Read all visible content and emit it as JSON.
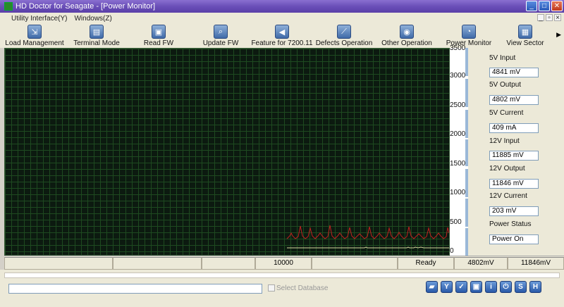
{
  "window": {
    "title": "HD Doctor for Seagate - [Power Monitor]"
  },
  "menu": {
    "items": [
      "Utility Interface(Y)",
      "Windows(Z)"
    ]
  },
  "toolbar": {
    "items": [
      "Load Management",
      "Terminal Mode",
      "Read FW",
      "Update FW",
      "Feature for 7200.11",
      "Defects Operation",
      "Other Operation",
      "Power Monitor",
      "View Sector"
    ]
  },
  "icons": {
    "toolbar": [
      "load-icon",
      "terminal-icon",
      "read-icon",
      "update-icon",
      "arrow-left-icon",
      "defects-icon",
      "disc-icon",
      "gauge-icon",
      "view-sector-icon"
    ],
    "bottom": [
      "folder-icon",
      "tools-icon",
      "check-icon",
      "save-icon",
      "info-icon",
      "power-icon",
      "s-icon",
      "h-icon"
    ]
  },
  "axis": {
    "ticks": [
      "3500",
      "3000",
      "2500",
      "2000",
      "1500",
      "1000",
      "500",
      "0"
    ]
  },
  "readings": {
    "v5_input_label": "5V Input",
    "v5_input_value": "4841  mV",
    "v5_output_label": "5V Output",
    "v5_output_value": "4802  mV",
    "v5_current_label": "5V Current",
    "v5_current_value": "409 mA",
    "v12_input_label": "12V Input",
    "v12_input_value": "11885  mV",
    "v12_output_label": "12V Output",
    "v12_output_value": "11846  mV",
    "v12_current_label": "12V Current",
    "v12_current_value": "203  mV",
    "status_label": "Power Status",
    "status_value": "Power On"
  },
  "statusbar": {
    "count": "10000",
    "state": "Ready",
    "v5": "4802mV",
    "v12": "11846mV"
  },
  "bottom": {
    "db_label": "Select Database",
    "db_value": ""
  },
  "colors": {
    "title_bar": "#6a4fb8",
    "graph_bg": "#0c1a10",
    "grid": "#1e4a20",
    "trace_current": "#c02020",
    "trace_voltage": "#d8d8a0"
  }
}
